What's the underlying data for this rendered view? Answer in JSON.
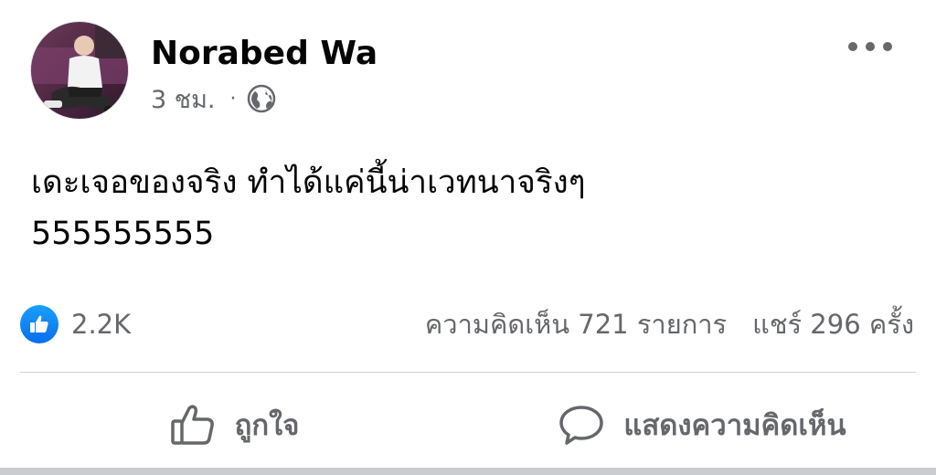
{
  "post": {
    "author_name": "Norabed Wa",
    "timestamp": "3 ชม.",
    "separator": "·",
    "privacy_icon": "globe-icon",
    "text_line1": "เดะเจอของจริง ทำได้แค่นี้น่าเวทนาจริงๆ",
    "text_line2": "555555555"
  },
  "reactions": {
    "like_icon": "like-reaction-icon",
    "like_count": "2.2K",
    "comments": "ความคิดเห็น 721 รายการ",
    "shares": "แชร์ 296 ครั้ง"
  },
  "actions": {
    "like_label": "ถูกใจ",
    "comment_label": "แสดงความคิดเห็น"
  },
  "colors": {
    "like_blue": "#1877f2",
    "secondary_text": "#65676b",
    "primary_text": "#050505"
  }
}
